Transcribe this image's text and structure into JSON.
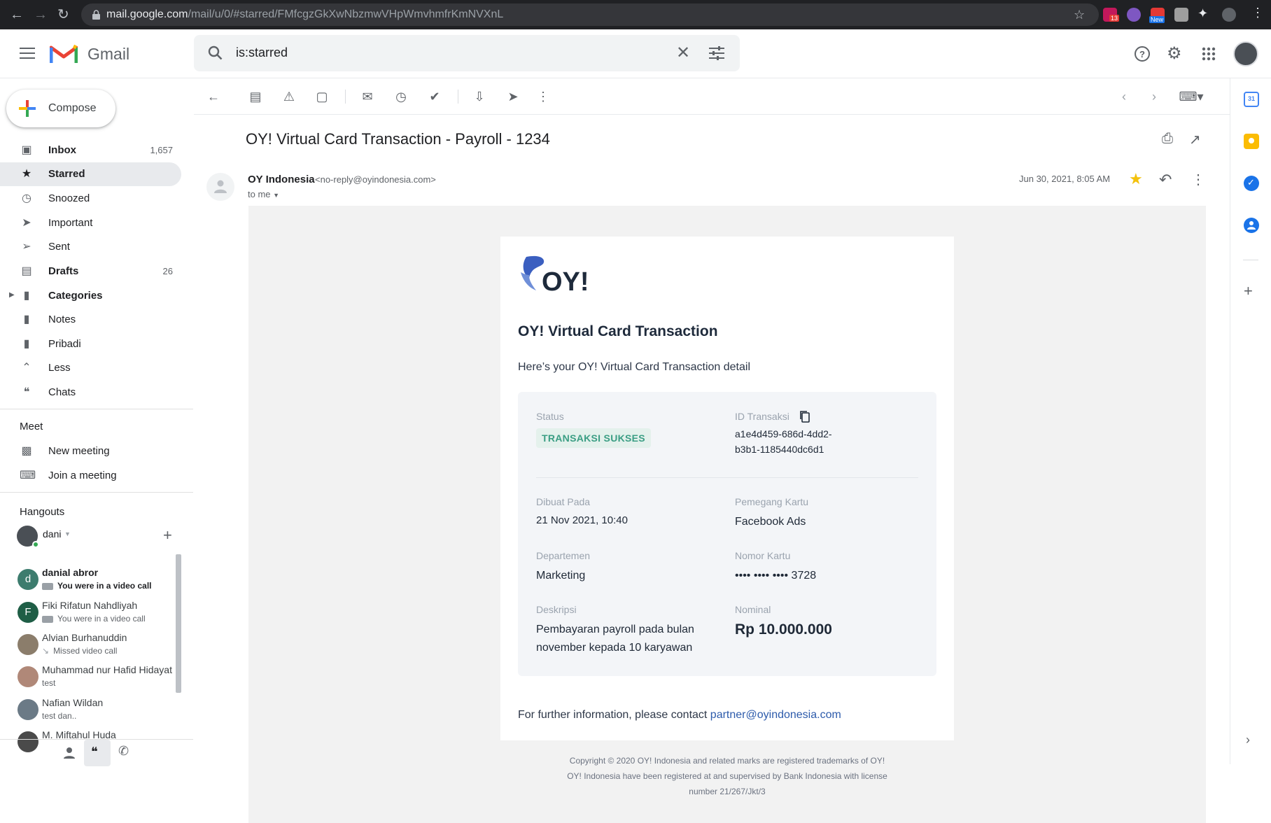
{
  "browser": {
    "url_host": "mail.google.com",
    "url_path": "/mail/u/0/#starred/FMfcgzGkXwNbzmwVHpWmvhmfrKmNVXnL",
    "ext_badge_count": "13",
    "ext_badge_new": "New"
  },
  "header": {
    "app_name": "Gmail",
    "search_value": "is:starred"
  },
  "sidebar": {
    "compose_label": "Compose",
    "items": [
      {
        "label": "Inbox",
        "count": "1,657",
        "bold": true,
        "icon": "inbox-icon"
      },
      {
        "label": "Starred",
        "count": "",
        "bold": true,
        "icon": "star-icon",
        "active": true
      },
      {
        "label": "Snoozed",
        "count": "",
        "icon": "clock-icon"
      },
      {
        "label": "Important",
        "count": "",
        "icon": "important-icon"
      },
      {
        "label": "Sent",
        "count": "",
        "icon": "send-icon"
      },
      {
        "label": "Drafts",
        "count": "26",
        "bold": true,
        "icon": "draft-icon"
      },
      {
        "label": "Categories",
        "count": "",
        "bold": true,
        "icon": "label-icon"
      },
      {
        "label": "Notes",
        "count": "",
        "icon": "label-icon"
      },
      {
        "label": "Pribadi",
        "count": "",
        "icon": "label-icon"
      },
      {
        "label": "Less",
        "count": "",
        "icon": "chevron-up-icon"
      },
      {
        "label": "Chats",
        "count": "",
        "icon": "chat-icon"
      }
    ],
    "meet": {
      "heading": "Meet",
      "new_meeting": "New meeting",
      "join_meeting": "Join a meeting"
    },
    "hangouts": {
      "heading": "Hangouts",
      "user": "dani",
      "contacts": [
        {
          "name": "danial abror",
          "status": "You were in a video call",
          "initial": "d",
          "color": "#3d7c6e",
          "bold": true
        },
        {
          "name": "Fiki Rifatun Nahdliyah",
          "status": "You were in a video call",
          "initial": "F",
          "color": "#1f5e46"
        },
        {
          "name": "Alvian Burhanuddin",
          "status": "Missed video call",
          "initial": "",
          "color": "#8b7d6b"
        },
        {
          "name": "Muhammad nur Hafid Hidayat",
          "status": "test",
          "initial": "",
          "color": "#b08878"
        },
        {
          "name": "Nafian Wildan",
          "status": "test dan..",
          "initial": "",
          "color": "#6b7a86"
        },
        {
          "name": "M. Miftahul Huda",
          "status": "",
          "initial": "",
          "color": "#4a4a4a"
        }
      ]
    }
  },
  "message": {
    "subject": "OY! Virtual Card Transaction - Payroll - 1234",
    "sender_name": "OY Indonesia",
    "sender_email": "<no-reply@oyindonesia.com>",
    "to": "to me",
    "date": "Jun 30, 2021, 8:05 AM"
  },
  "email": {
    "logo_text": "OY!",
    "title": "OY! Virtual Card Transaction",
    "intro": "Here’s your OY! Virtual Card Transaction detail",
    "status_label": "Status",
    "status_value": "TRANSAKSI SUKSES",
    "id_label": "ID Transaksi",
    "id_line1": "a1e4d459-686d-4dd2-",
    "id_line2": "b3b1-1185440dc6d1",
    "created_label": "Dibuat Pada",
    "created_value": "21 Nov 2021, 10:40",
    "holder_label": "Pemegang Kartu",
    "holder_value": "Facebook Ads",
    "dept_label": "Departemen",
    "dept_value": "Marketing",
    "card_label": "Nomor Kartu",
    "card_value": "•••• •••• •••• 3728",
    "desc_label": "Deskripsi",
    "desc_line1": "Pembayaran payroll pada bulan",
    "desc_line2": "november kepada 10 karyawan",
    "amount_label": "Nominal",
    "amount_value": "Rp 10.000.000",
    "footer_text": "For further information, please contact ",
    "footer_link": "partner@oyindonesia.com",
    "copyright_1": "Copyright © 2020 OY! Indonesia and related marks are registered trademarks of OY!",
    "copyright_2": "OY! Indonesia have been registered at and supervised by Bank Indonesia with license",
    "copyright_3": "number 21/267/Jkt/3"
  },
  "colors": {
    "oy_blue": "#3b5fc0",
    "oy_navy": "#1e2a3b",
    "status_green": "#3b9e84",
    "star_yellow": "#f4c20d"
  }
}
